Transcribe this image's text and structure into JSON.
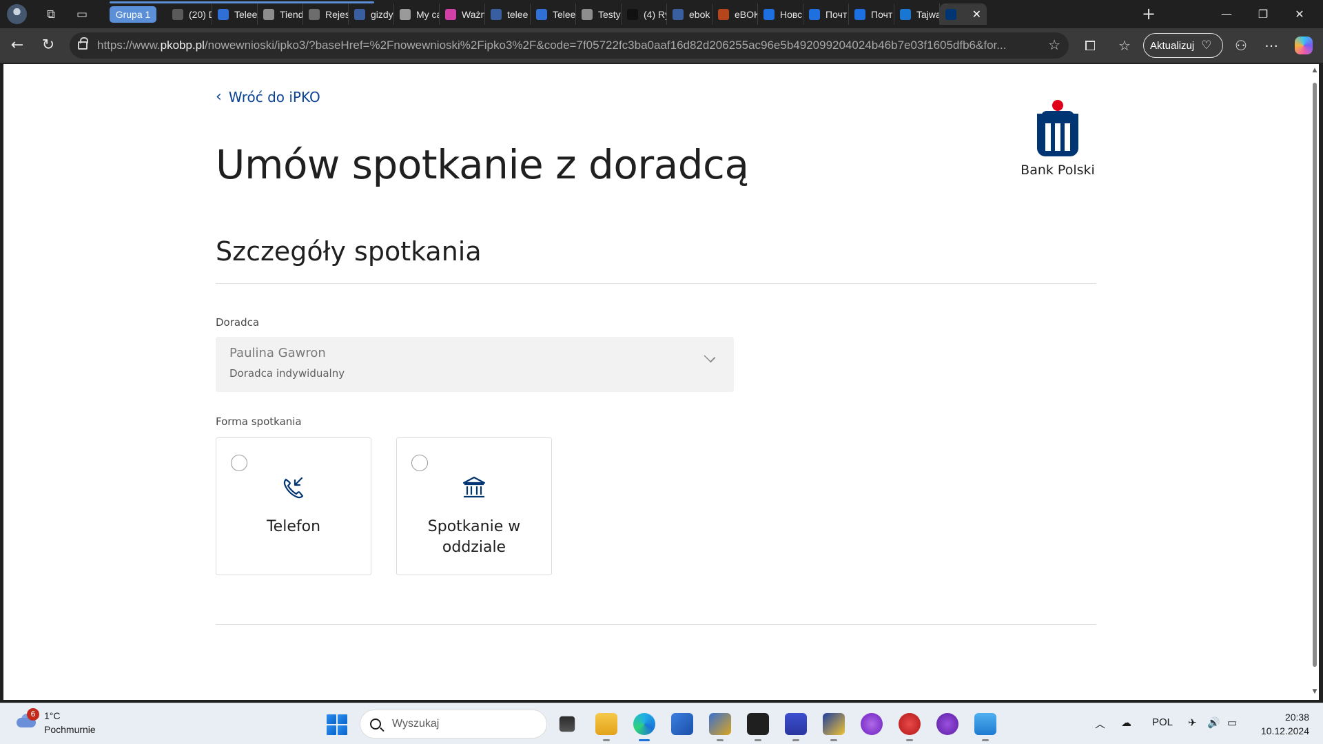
{
  "browser": {
    "group_label": "Grupa 1",
    "tabs": [
      {
        "title": "(20) D",
        "color": "#5a5a5a"
      },
      {
        "title": "Telee",
        "color": "#2f6fd6"
      },
      {
        "title": "Tiend",
        "color": "#8d8d8d"
      },
      {
        "title": "Rejes",
        "color": "#6d6d6d"
      },
      {
        "title": "gizdy",
        "color": "#3a5fa0"
      },
      {
        "title": "My ca",
        "color": "#9a9a9a"
      },
      {
        "title": "Ważn",
        "color": "#d23fa6"
      },
      {
        "title": "telee",
        "color": "#3a5fa0"
      },
      {
        "title": "Telee",
        "color": "#2f6fd6"
      },
      {
        "title": "Testy",
        "color": "#8d8d8d"
      },
      {
        "title": "(4) Ry",
        "color": "#111111"
      },
      {
        "title": "ebok",
        "color": "#3a5fa0"
      },
      {
        "title": "eBOK",
        "color": "#b5451b"
      },
      {
        "title": "Новс",
        "color": "#1e6fe0"
      },
      {
        "title": "Почт",
        "color": "#1e6fe0"
      },
      {
        "title": "Почт",
        "color": "#1e6fe0"
      },
      {
        "title": "Tajwa",
        "color": "#1976d2"
      },
      {
        "title": "",
        "color": "#003574"
      }
    ],
    "url_prefix": "https://www.",
    "url_host": "pkobp.pl",
    "url_path": "/nowewnioski/ipko3/?baseHref=%2Fnowewnioski%2Fipko3%2F&code=7f05722fc3ba0aaf16d82d206255ac96e5b492099204024b46b7e03f1605dfb6&for...",
    "update_label": "Aktualizuj"
  },
  "page": {
    "back_link": "Wróć do iPKO",
    "title": "Umów spotkanie z doradcą",
    "logo_text": "Bank Polski",
    "section_title": "Szczegóły spotkania",
    "advisor": {
      "label": "Doradca",
      "name": "Paulina Gawron",
      "role": "Doradca indywidualny"
    },
    "meeting_form": {
      "label": "Forma spotkania",
      "options": [
        {
          "label": "Telefon",
          "icon": "phone-incoming-icon"
        },
        {
          "label": "Spotkanie w oddziale",
          "icon": "bank-building-icon"
        }
      ]
    },
    "colors": {
      "accent": "#0a4393",
      "logo_blue": "#003574",
      "logo_red": "#e1001a"
    }
  },
  "taskbar": {
    "weather_badge": "6",
    "temperature": "1°C",
    "condition": "Pochmurnie",
    "search_placeholder": "Wyszukaj",
    "language": "POL",
    "time": "20:38",
    "date": "10.12.2024"
  }
}
